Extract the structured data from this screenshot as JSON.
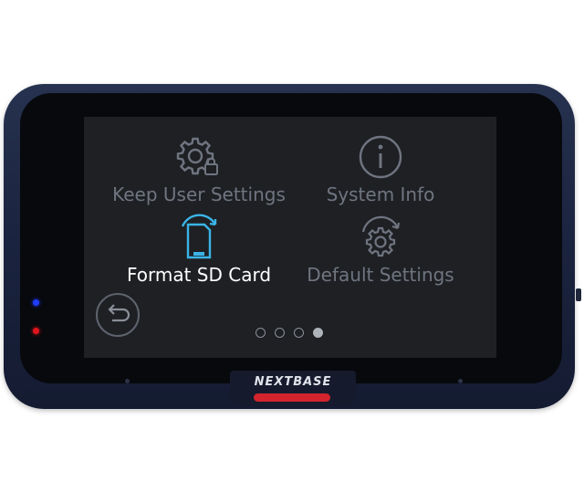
{
  "device": {
    "brand": "NEXTBASE"
  },
  "menu": {
    "items": [
      {
        "label": "Keep User Settings",
        "icon": "gear-lock-icon",
        "selected": false
      },
      {
        "label": "System Info",
        "icon": "info-circle-icon",
        "selected": false
      },
      {
        "label": "Format SD Card",
        "icon": "sd-card-refresh-icon",
        "selected": true
      },
      {
        "label": "Default Settings",
        "icon": "gear-refresh-icon",
        "selected": false
      }
    ]
  },
  "navigation": {
    "back_icon": "back-arrow-icon",
    "page_count": 4,
    "current_page": 4
  },
  "colors": {
    "selected_icon": "#3ab4e6",
    "selected_text": "#ffffff",
    "inactive": "#6f7580",
    "record_button": "#d3242e",
    "led_blue": "#1f3cff",
    "led_red": "#e0141c"
  }
}
